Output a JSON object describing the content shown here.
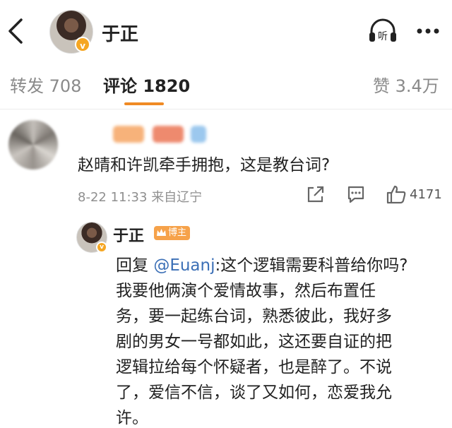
{
  "header": {
    "title": "于正",
    "verified_badge": "v"
  },
  "tabs": [
    {
      "label": "转发",
      "count": "708"
    },
    {
      "label": "评论",
      "count": "1820"
    },
    {
      "label": "赞",
      "count": "3.4万"
    }
  ],
  "comment": {
    "text": "赵晴和许凯牵手拥抱，这是教台词?",
    "time": "8-22 11:33",
    "location": "来自辽宁",
    "likes": "4171"
  },
  "reply": {
    "author": "于正",
    "badge": "博主",
    "prefix": "回复",
    "mention": "@Euanj",
    "first_line_rest": ":这个逻辑需要科普给你吗?",
    "lines": [
      "我要他俩演个爱情故事，然后布置任",
      "务，要一起练台词，熟悉彼此，我好多",
      "剧的男女一号都如此，这还要自证的把",
      "逻辑拉给每个怀疑者，也是醉了。不说",
      "了，爱信不信，谈了又如何，恋爱我允",
      "许。"
    ]
  },
  "colors": {
    "accent": "#f08a24",
    "link": "#3b6fb6",
    "badge": "#f6a24a",
    "vip": "#f5a623"
  },
  "icons": [
    "back-arrow-icon",
    "listen-icon",
    "more-dots-icon",
    "share-icon",
    "reply-icon",
    "like-icon",
    "crown-icon"
  ]
}
